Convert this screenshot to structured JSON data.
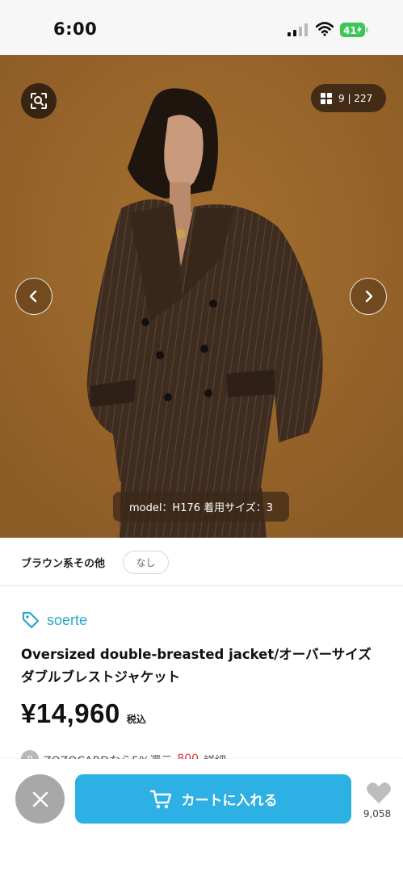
{
  "status_bar": {
    "time": "6:00",
    "battery": "41"
  },
  "gallery": {
    "counter": "9 | 227",
    "caption": "model：H176 着用サイズ：3",
    "icons": [
      "lens-search-icon",
      "grid-icon",
      "chevron-left-icon",
      "chevron-right-icon"
    ]
  },
  "color_selector": {
    "color_name": "ブラウン系その他",
    "size_option": "なし"
  },
  "product": {
    "brand": "soerte",
    "name": "Oversized double-breasted jacket/オーバーサイズダブルブレストジャケット",
    "price": "¥14,960",
    "tax_label": "税込"
  },
  "promo": {
    "badge": "P",
    "text": "ZOZOCARDなら5%還元",
    "points": "800",
    "more": "詳細"
  },
  "bottom_bar": {
    "cart_label": "カートに入れる",
    "favorite_count": "9,058"
  },
  "colors": {
    "brand_accent": "#2aa7c9",
    "cart_button": "#2db0e3",
    "close_button": "#a8a8a8",
    "photo_background": "#9a672d"
  }
}
